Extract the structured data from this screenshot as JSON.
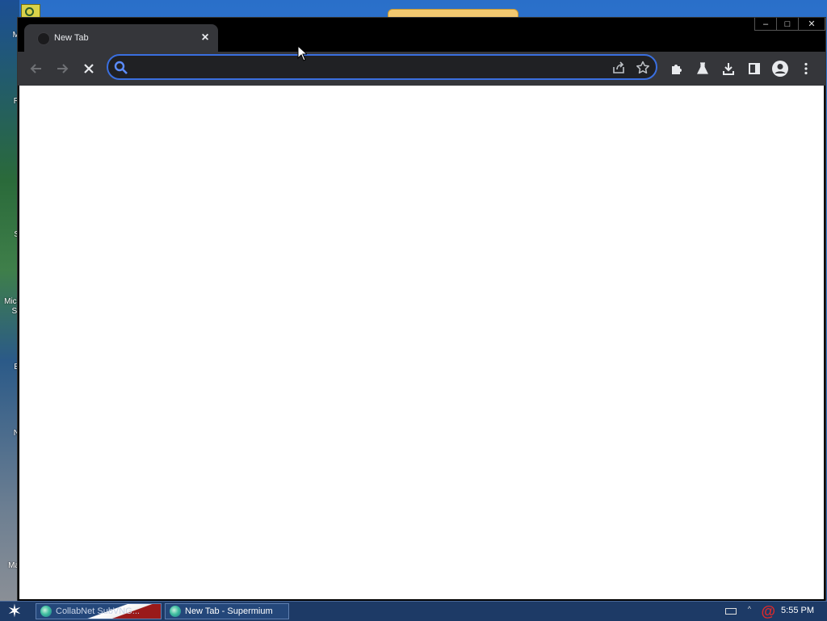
{
  "desktop": {
    "icon_labels": [
      "M",
      "R",
      "S",
      "Micr",
      "St",
      "E",
      "N",
      "Ma"
    ]
  },
  "browser": {
    "tab": {
      "title": "New Tab",
      "close_symbol": "×"
    },
    "window_controls": {
      "minimize": "–",
      "maximize": "□",
      "close": "✕"
    },
    "toolbar": {
      "back_icon": "arrow-left",
      "forward_icon": "arrow-right",
      "stop_icon": "x",
      "omnibox": {
        "value": "",
        "placeholder": ""
      },
      "right_icons": [
        "share",
        "star",
        "puzzle",
        "flask",
        "download",
        "side-panel",
        "profile",
        "kebab-menu"
      ]
    },
    "accent_color": "#3a6fe0"
  },
  "taskbar": {
    "items": [
      {
        "label": "CollabNet SubVNG..."
      },
      {
        "label": "New Tab - Supermium"
      }
    ],
    "clock": "5:55 PM"
  }
}
